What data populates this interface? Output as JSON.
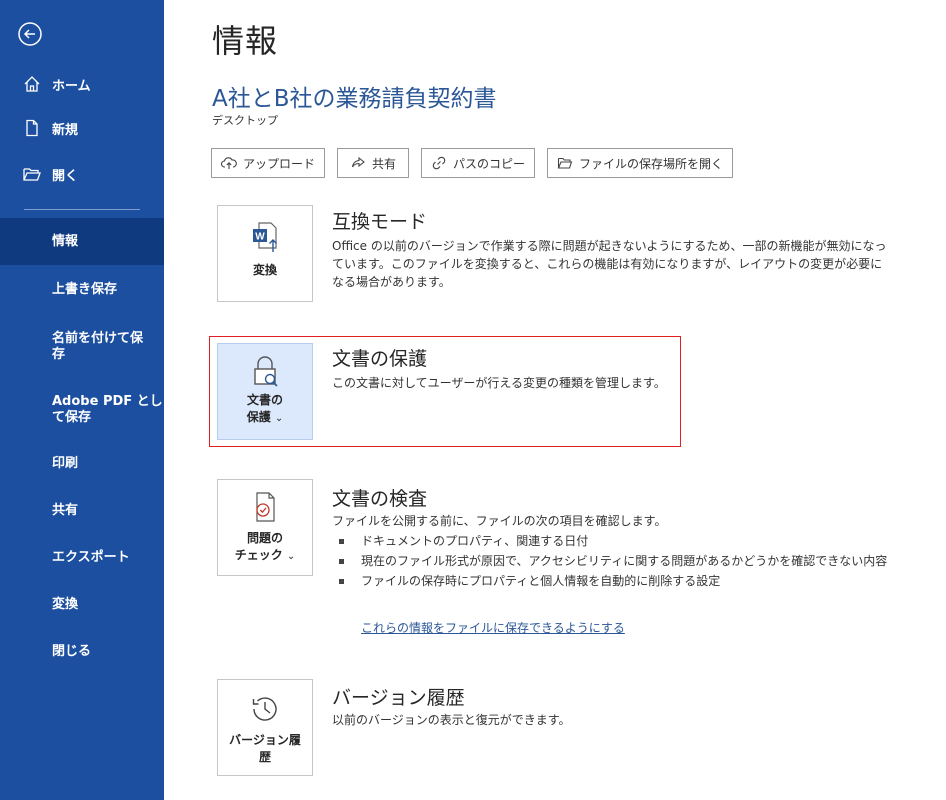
{
  "sidebar": {
    "top_items": [
      {
        "label": "ホーム",
        "icon": "home-icon"
      },
      {
        "label": "新規",
        "icon": "new-document-icon"
      },
      {
        "label": "開く",
        "icon": "open-folder-icon"
      }
    ],
    "items": [
      {
        "label": "情報",
        "active": true
      },
      {
        "label": "上書き保存"
      },
      {
        "label": "名前を付けて保\n存"
      },
      {
        "label": "Adobe PDF とし\nて保存"
      },
      {
        "label": "印刷"
      },
      {
        "label": "共有"
      },
      {
        "label": "エクスポート"
      },
      {
        "label": "変換"
      },
      {
        "label": "閉じる"
      }
    ]
  },
  "header": {
    "title": "情報",
    "document_title": "A社とB社の業務請負契約書",
    "location": "デスクトップ"
  },
  "actions": [
    {
      "label": "アップロード",
      "icon": "cloud-upload-icon"
    },
    {
      "label": "共有",
      "icon": "share-icon"
    },
    {
      "label": "パスのコピー",
      "icon": "link-icon"
    },
    {
      "label": "ファイルの保存場所を開く",
      "icon": "folder-open-icon"
    }
  ],
  "sections": {
    "compat": {
      "button_label": "変換",
      "title": "互換モード",
      "description": "Office の以前のバージョンで作業する際に問題が起きないようにするため、一部の新機能が無効になっています。このファイルを変換すると、これらの機能は有効になりますが、レイアウトの変更が必要になる場合があります。"
    },
    "protect": {
      "button_label_1": "文書の",
      "button_label_2": "保護",
      "title": "文書の保護",
      "description": "この文書に対してユーザーが行える変更の種類を管理します。"
    },
    "inspect": {
      "button_label_1": "問題の",
      "button_label_2": "チェック",
      "title": "文書の検査",
      "description": "ファイルを公開する前に、ファイルの次の項目を確認します。",
      "bullets": [
        "ドキュメントのプロパティ、関連する日付",
        "現在のファイル形式が原因で、アクセシビリティに関する問題があるかどうかを確認できない内容",
        "ファイルの保存時にプロパティと個人情報を自動的に削除する設定"
      ],
      "link": "これらの情報をファイルに保存できるようにする"
    },
    "version": {
      "button_label_1": "バージョン履",
      "button_label_2": "歴",
      "title": "バージョン履歴",
      "description": "以前のバージョンの表示と復元ができます。"
    }
  },
  "colors": {
    "sidebar": "#1c4fa0",
    "sidebar_active": "#0f3a80",
    "accent": "#2b5797",
    "highlight": "#e02020"
  }
}
